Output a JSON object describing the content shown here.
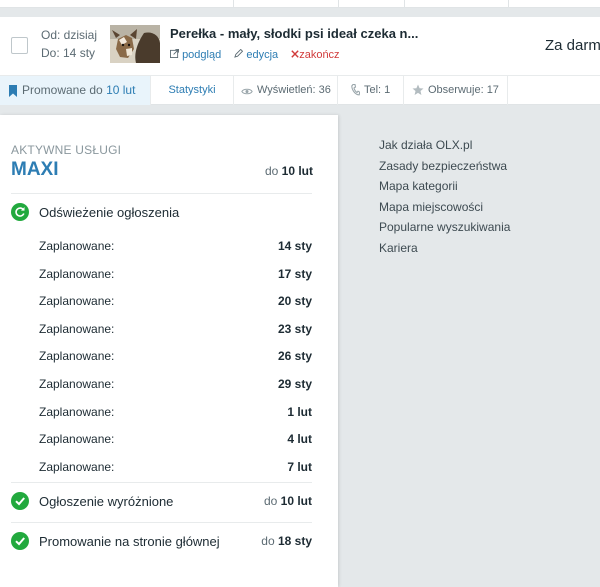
{
  "listing": {
    "date_from": "Od: dzisiaj",
    "date_to": "Do: 14 sty",
    "title": "Perełka - mały, słodki psi ideał czeka n...",
    "actions": {
      "preview": "podgląd",
      "edit": "edycja",
      "end": "zakończ"
    },
    "price": "Za darmo"
  },
  "stats": {
    "promo_prefix": "Promowane do",
    "promo_date": "10 lut",
    "statistics_link": "Statystyki",
    "views": "Wyświetleń: 36",
    "phone": "Tel: 1",
    "watchers": "Obserwuje: 17"
  },
  "panel": {
    "caption": "AKTYWNE USŁUGI",
    "package_name": "MAXI",
    "package_until_prefix": "do",
    "package_until": "10 lut",
    "refresh_label": "Odświeżenie ogłoszenia",
    "schedule_label": "Zaplanowane:",
    "schedule": [
      "14 sty",
      "17 sty",
      "20 sty",
      "23 sty",
      "26 sty",
      "29 sty",
      "1 lut",
      "4 lut",
      "7 lut"
    ],
    "featured_label": "Ogłoszenie wyróżnione",
    "featured_prefix": "do",
    "featured_until": "10 lut",
    "homepage_label": "Promowanie na stronie głównej",
    "homepage_prefix": "do",
    "homepage_until": "18 sty"
  },
  "footer_links": [
    "Jak działa OLX.pl",
    "Zasady bezpieczeństwa",
    "Mapa kategorii",
    "Mapa miejscowości",
    "Popularne wyszukiwania",
    "Kariera"
  ],
  "colors": {
    "accent": "#2d7db3",
    "success": "#22a93e",
    "danger": "#d13b3b",
    "background": "#e4e8ea"
  }
}
